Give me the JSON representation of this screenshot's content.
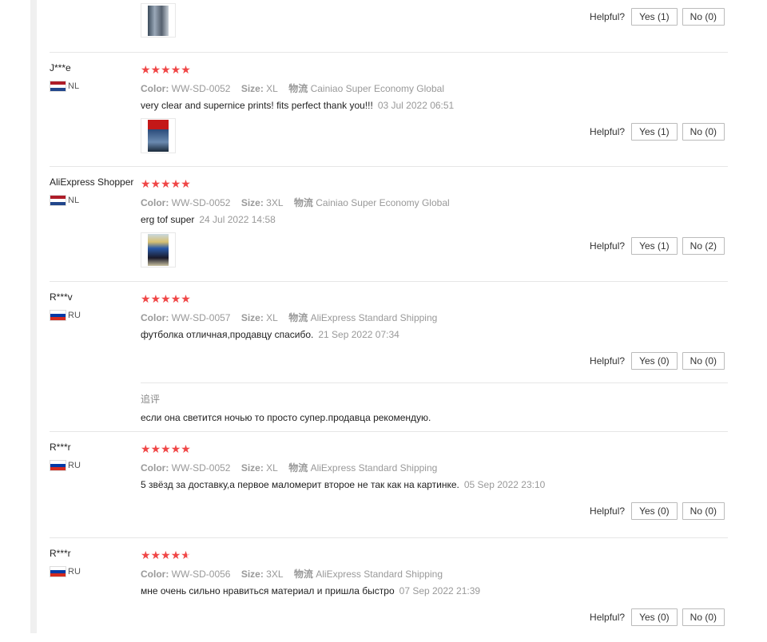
{
  "helpful_label": "Helpful?",
  "labels": {
    "color": "Color:",
    "size": "Size:",
    "shipping": "物流"
  },
  "top_partial": {
    "yes": "Yes (1)",
    "no": "No (0)"
  },
  "reviews": [
    {
      "user": "J***e",
      "country": "NL",
      "color": "WW-SD-0052",
      "size": "XL",
      "shipping": "Cainiao Super Economy Global",
      "text": "very clear and supernice prints! fits perfect thank you!!!",
      "date": "03 Jul 2022 06:51",
      "yes": "Yes (1)",
      "no": "No (0)"
    },
    {
      "user": "AliExpress Shopper",
      "country": "NL",
      "color": "WW-SD-0052",
      "size": "3XL",
      "shipping": "Cainiao Super Economy Global",
      "text": "erg tof super",
      "date": "24 Jul 2022 14:58",
      "yes": "Yes (1)",
      "no": "No (2)"
    },
    {
      "user": "R***v",
      "country": "RU",
      "color": "WW-SD-0057",
      "size": "XL",
      "shipping": "AliExpress Standard Shipping",
      "text": "футболка отличная,продавцу спасибо.",
      "date": "21 Sep 2022 07:34",
      "yes": "Yes (0)",
      "no": "No (0)",
      "followup_label": "追评",
      "followup_text": "если она светится ночью то просто супер.продавца рекомендую."
    },
    {
      "user": "R***r",
      "country": "RU",
      "color": "WW-SD-0052",
      "size": "XL",
      "shipping": "AliExpress Standard Shipping",
      "text": "5 звёзд за доставку,а первое маломерит второе не так как на картинке.",
      "date": "05 Sep 2022 23:10",
      "yes": "Yes (0)",
      "no": "No (0)"
    },
    {
      "user": "R***r",
      "country": "RU",
      "color": "WW-SD-0056",
      "size": "3XL",
      "shipping": "AliExpress Standard Shipping",
      "text": "мне очень сильно нравиться материал и пришла быстро",
      "date": "07 Sep 2022 21:39",
      "yes": "Yes (0)",
      "no": "No (0)"
    }
  ]
}
